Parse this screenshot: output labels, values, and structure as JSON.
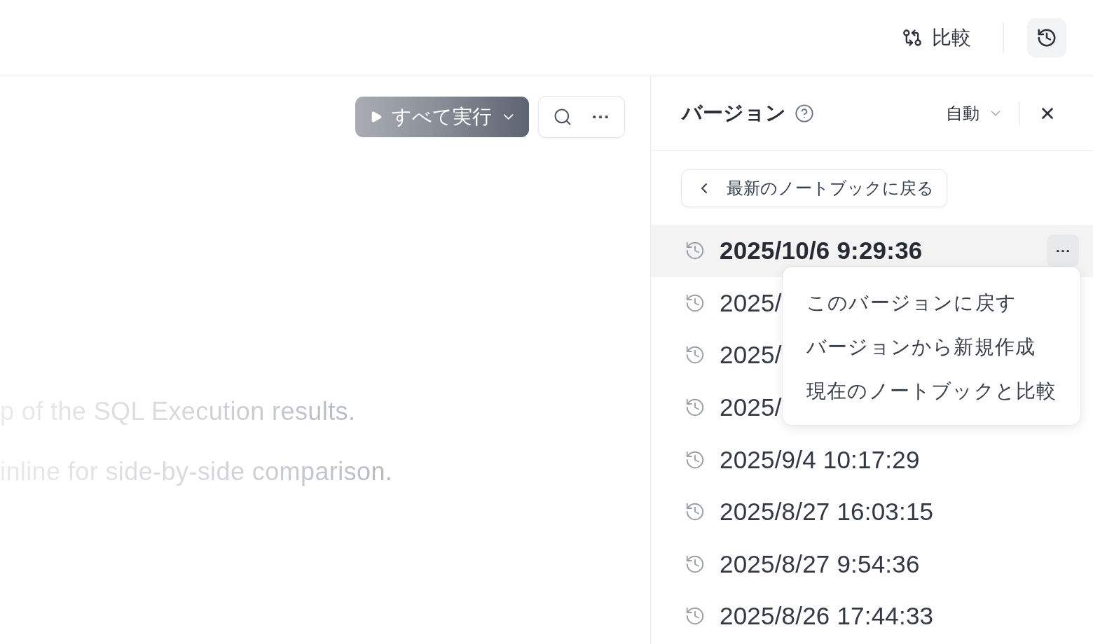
{
  "topbar": {
    "compare_button": {
      "label": "比較"
    },
    "history_button": {
      "active": true
    }
  },
  "notebook": {
    "toolbar": {
      "run_all": {
        "label": "すべて実行"
      }
    },
    "lines": [
      "p of the SQL Execution results.",
      "inline for side-by-side comparison."
    ]
  },
  "versions_panel": {
    "title": "バージョン",
    "mode": "自動",
    "back_button": "最新のノートブックに戻る",
    "versions": [
      {
        "time": "2025/10/6 9:29:36",
        "selected": true,
        "menu_open": true
      },
      {
        "time": "2025/",
        "selected": false,
        "menu_open": false
      },
      {
        "time": "2025/",
        "selected": false,
        "menu_open": false
      },
      {
        "time": "2025/",
        "selected": false,
        "menu_open": false
      },
      {
        "time": "2025/9/4 10:17:29",
        "selected": false,
        "menu_open": false
      },
      {
        "time": "2025/8/27 16:03:15",
        "selected": false,
        "menu_open": false
      },
      {
        "time": "2025/8/27 9:54:36",
        "selected": false,
        "menu_open": false
      },
      {
        "time": "2025/8/26 17:44:33",
        "selected": false,
        "menu_open": false
      }
    ],
    "row_menu": {
      "items": [
        "このバージョンに戻す",
        "バージョンから新規作成",
        "現在のノートブックと比較"
      ]
    }
  }
}
